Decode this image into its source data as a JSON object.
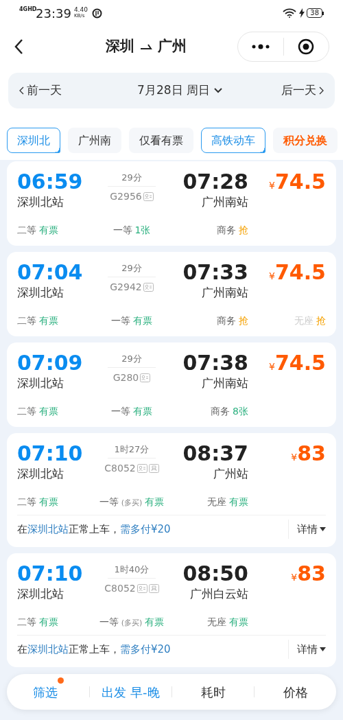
{
  "status_bar": {
    "network": "4GHD",
    "time": "23:39",
    "speed_value": "4.40",
    "speed_unit": "KB/s",
    "battery": "38"
  },
  "header": {
    "title_from": "深圳",
    "title_to": "广州"
  },
  "date_bar": {
    "prev": "前一天",
    "date": "7月28日 周日",
    "next": "后一天"
  },
  "chips": [
    {
      "label": "深圳北",
      "kind": "filter",
      "selected": true
    },
    {
      "label": "广州南",
      "kind": "filter",
      "selected": false
    },
    {
      "label": "仅看有票",
      "kind": "filter",
      "selected": false
    },
    {
      "label": "高铁动车",
      "kind": "filter",
      "selected": true
    },
    {
      "label": "积分兑换",
      "kind": "promo",
      "selected": false
    }
  ],
  "trains": [
    {
      "dep_time": "06:59",
      "dep_station": "深圳北站",
      "duration": "29分",
      "number": "G2956",
      "id_badge": true,
      "extra_badge": false,
      "arr_time": "07:28",
      "arr_station": "广州南站",
      "currency": "¥",
      "price": "74.5",
      "seats": [
        {
          "class": "二等",
          "status": "有票",
          "kind": "available",
          "muted": false
        },
        {
          "class": "一等",
          "status": "1张",
          "kind": "available",
          "muted": false
        },
        {
          "class": "商务",
          "status": "抢",
          "kind": "grab",
          "muted": false
        }
      ]
    },
    {
      "dep_time": "07:04",
      "dep_station": "深圳北站",
      "duration": "29分",
      "number": "G2942",
      "id_badge": true,
      "extra_badge": false,
      "arr_time": "07:33",
      "arr_station": "广州南站",
      "currency": "¥",
      "price": "74.5",
      "seats": [
        {
          "class": "二等",
          "status": "有票",
          "kind": "available",
          "muted": false
        },
        {
          "class": "一等",
          "status": "有票",
          "kind": "available",
          "muted": false
        },
        {
          "class": "商务",
          "status": "抢",
          "kind": "grab",
          "muted": false
        },
        {
          "class": "无座",
          "status": "抢",
          "kind": "grab",
          "muted": true
        }
      ]
    },
    {
      "dep_time": "07:09",
      "dep_station": "深圳北站",
      "duration": "29分",
      "number": "G280",
      "id_badge": true,
      "extra_badge": false,
      "arr_time": "07:38",
      "arr_station": "广州南站",
      "currency": "¥",
      "price": "74.5",
      "seats": [
        {
          "class": "二等",
          "status": "有票",
          "kind": "available",
          "muted": false
        },
        {
          "class": "一等",
          "status": "有票",
          "kind": "available",
          "muted": false
        },
        {
          "class": "商务",
          "status": "8张",
          "kind": "available",
          "muted": false
        }
      ]
    },
    {
      "dep_time": "07:10",
      "dep_station": "深圳北站",
      "duration": "1时27分",
      "number": "C8052",
      "id_badge": true,
      "extra_badge": true,
      "arr_time": "08:37",
      "arr_station": "广州站",
      "currency": "¥",
      "price": "83",
      "seats": [
        {
          "class": "二等",
          "status": "有票",
          "kind": "available",
          "muted": false
        },
        {
          "class": "一等",
          "note": "(多买)",
          "status": "有票",
          "kind": "available",
          "muted": false
        },
        {
          "class": "无座",
          "status": "有票",
          "kind": "available",
          "muted": false
        }
      ],
      "notice": {
        "parts": [
          {
            "text": "在",
            "highlight": false
          },
          {
            "text": "深圳北站",
            "highlight": true
          },
          {
            "text": "正常上车，",
            "highlight": false
          },
          {
            "text": "需多付¥20",
            "highlight": true
          }
        ],
        "details": "详情"
      }
    },
    {
      "dep_time": "07:10",
      "dep_station": "深圳北站",
      "duration": "1时40分",
      "number": "C8052",
      "id_badge": true,
      "extra_badge": true,
      "arr_time": "08:50",
      "arr_station": "广州白云站",
      "currency": "¥",
      "price": "83",
      "seats": [
        {
          "class": "二等",
          "status": "有票",
          "kind": "available",
          "muted": false
        },
        {
          "class": "一等",
          "note": "(多买)",
          "status": "有票",
          "kind": "available",
          "muted": false
        },
        {
          "class": "无座",
          "status": "有票",
          "kind": "available",
          "muted": false
        }
      ],
      "notice": {
        "parts": [
          {
            "text": "在",
            "highlight": false
          },
          {
            "text": "深圳北站",
            "highlight": true
          },
          {
            "text": "正常上车，",
            "highlight": false
          },
          {
            "text": "需多付¥20",
            "highlight": true
          }
        ],
        "details": "详情"
      }
    }
  ],
  "bottom_bar": [
    {
      "label": "筛选",
      "selected": true,
      "dot": true
    },
    {
      "label": "出发 早-晚",
      "selected": true,
      "dot": false
    },
    {
      "label": "耗时",
      "selected": false,
      "dot": false
    },
    {
      "label": "价格",
      "selected": false,
      "dot": false
    }
  ]
}
